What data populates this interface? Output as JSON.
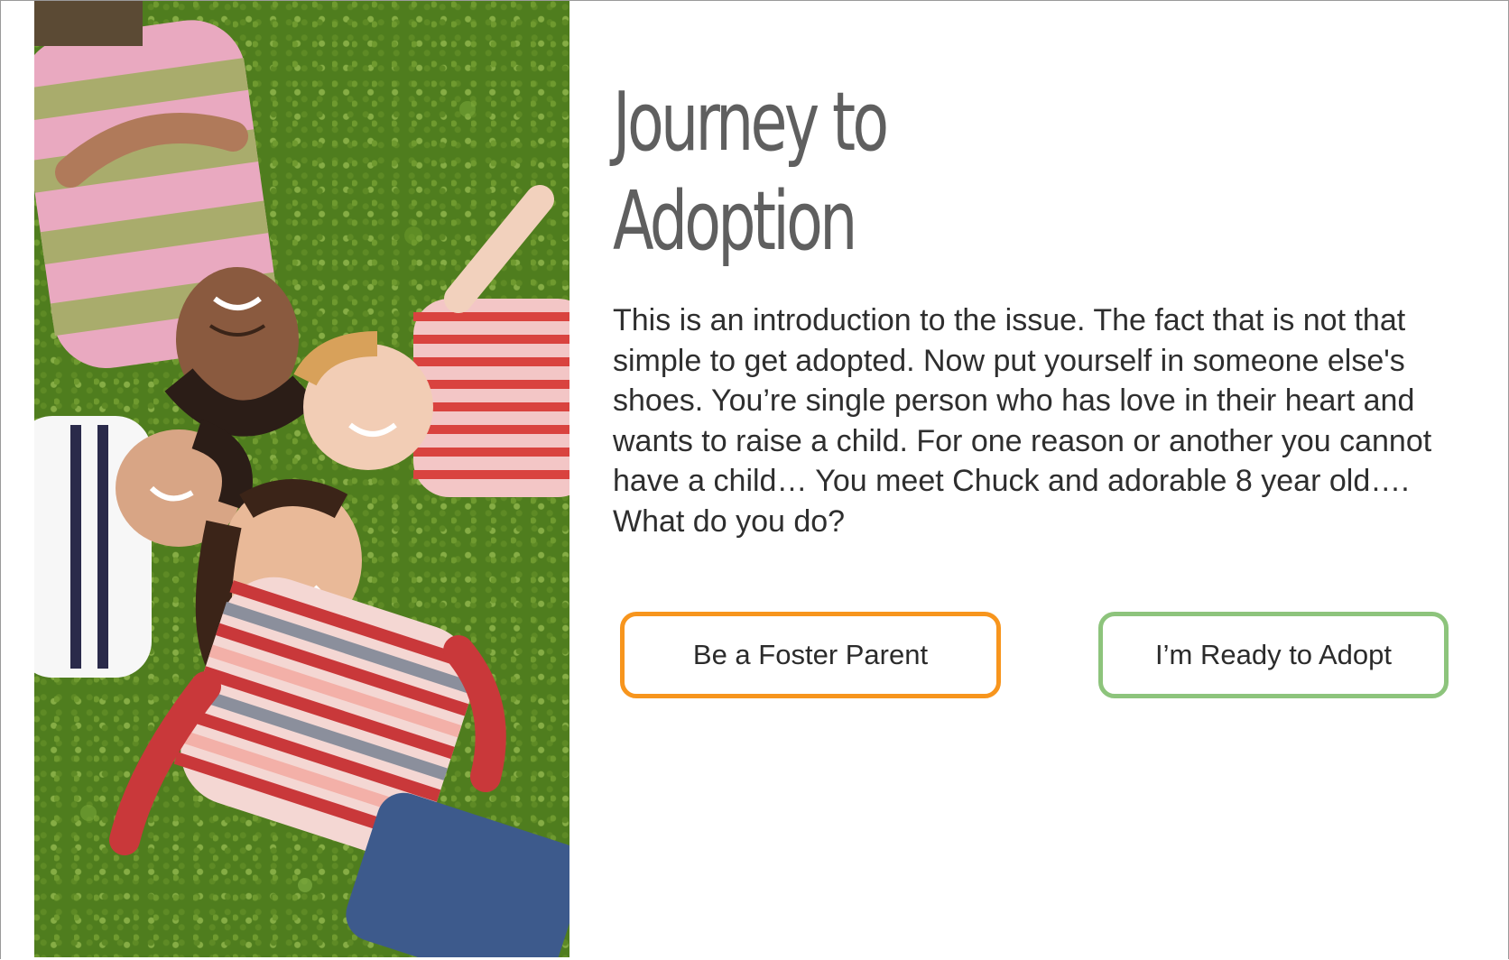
{
  "page": {
    "title_line1": "Journey to",
    "title_line2": "Adoption",
    "intro": "This is an introduction to the issue. The fact that is not that simple to get adopted. Now put yourself in someone else's shoes. You’re single person who has love in their heart and wants to raise a child. For one reason or another you cannot have a child… You meet Chuck and adorable 8 year old…. What do you do?"
  },
  "photo": {
    "subject": "Four children lying on grass with heads together, smiling",
    "accent_colors": [
      "#4f7d1e",
      "#e9a9c0",
      "#a9ac6c",
      "#d9433f"
    ]
  },
  "buttons": {
    "foster_label": "Be a Foster Parent",
    "adopt_label": "I’m Ready to Adopt",
    "foster_border_color": "#f7951d",
    "adopt_border_color": "#8dc47c"
  }
}
